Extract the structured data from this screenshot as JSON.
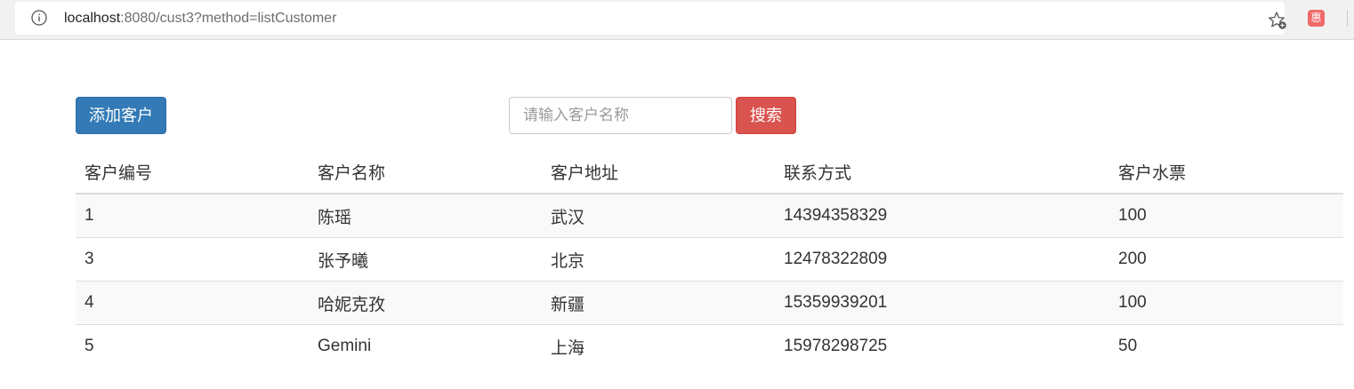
{
  "browser": {
    "url_host": "localhost",
    "url_path": ":8080/cust3?method=listCustomer",
    "extension_glyph": "惠"
  },
  "toolbar": {
    "add_label": "添加客户",
    "search_placeholder": "请输入客户名称",
    "search_label": "搜索"
  },
  "table": {
    "headers": [
      "客户编号",
      "客户名称",
      "客户地址",
      "联系方式",
      "客户水票"
    ],
    "rows": [
      [
        "1",
        "陈瑶",
        "武汉",
        "14394358329",
        "100"
      ],
      [
        "3",
        "张予曦",
        "北京",
        "12478322809",
        "200"
      ],
      [
        "4",
        "哈妮克孜",
        "新疆",
        "15359939201",
        "100"
      ],
      [
        "5",
        "Gemini",
        "上海",
        "15978298725",
        "50"
      ]
    ]
  },
  "colors": {
    "primary": "#337ab7",
    "danger": "#d9534f",
    "stripe": "#f9f9f9"
  }
}
